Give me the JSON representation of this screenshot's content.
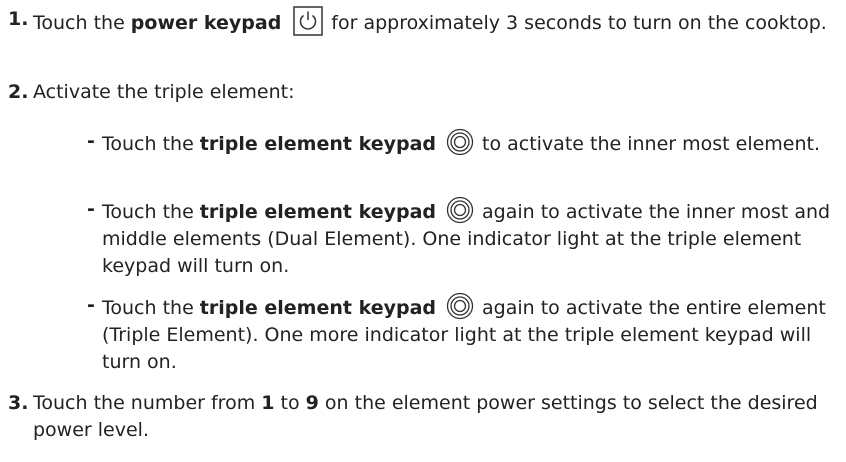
{
  "steps": [
    {
      "number": "1.",
      "text_before": "Touch the ",
      "bold": "power keypad",
      "icon": "power-icon",
      "text_after": "for approximately 3 seconds to turn on the cooktop."
    },
    {
      "number": "2.",
      "text": "Activate the triple element:",
      "bullets": [
        {
          "dash": "-",
          "text_before": "Touch the ",
          "bold": "triple element keypad",
          "icon": "triple-element-icon",
          "text_after": "to activate the inner most element."
        },
        {
          "dash": "-",
          "text_before": "Touch the ",
          "bold": "triple element keypad",
          "icon": "triple-element-icon",
          "text_after": "again to activate the inner most and middle elements (Dual Element). One indicator light at the triple element keypad will turn on."
        },
        {
          "dash": "-",
          "text_before": "Touch the ",
          "bold": "triple element keypad",
          "icon": "triple-element-icon",
          "text_after": "again to activate the entire element (Triple Element). One more indicator light at the triple element keypad will turn on."
        }
      ]
    },
    {
      "number": "3.",
      "text_before": "Touch the number from ",
      "bold_from": "1",
      "text_mid": " to ",
      "bold_to": "9",
      "text_after": " on the element power settings to select the desired power level."
    }
  ]
}
